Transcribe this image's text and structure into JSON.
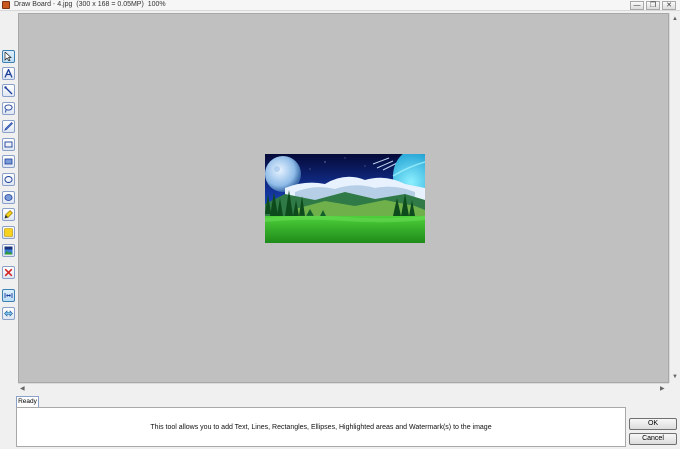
{
  "window": {
    "app_title": "Draw Board",
    "separator": "-",
    "file_name": "4.jpg",
    "file_info": "(300 x 168 = 0.05MP)",
    "zoom": "100%",
    "minimize_glyph": "—",
    "restore_glyph": "❐",
    "close_glyph": "✕"
  },
  "toolbar": {
    "tools": [
      {
        "name": "select",
        "icon": "pointer-icon"
      },
      {
        "name": "text",
        "icon": "text-icon"
      },
      {
        "name": "line",
        "icon": "line-icon"
      },
      {
        "name": "lasso",
        "icon": "lasso-icon"
      },
      {
        "name": "pen",
        "icon": "pen-icon"
      },
      {
        "name": "rectangle",
        "icon": "rectangle-icon"
      },
      {
        "name": "filled-rectangle",
        "icon": "filled-rectangle-icon"
      },
      {
        "name": "ellipse",
        "icon": "ellipse-icon"
      },
      {
        "name": "filled-ellipse",
        "icon": "filled-ellipse-icon"
      },
      {
        "name": "highlighter",
        "icon": "highlighter-icon"
      },
      {
        "name": "highlight-area",
        "icon": "highlight-area-icon"
      },
      {
        "name": "watermark",
        "icon": "watermark-image-icon"
      },
      {
        "name": "delete",
        "icon": "delete-icon"
      },
      {
        "name": "fit",
        "icon": "fit-to-window-icon"
      },
      {
        "name": "actual-size",
        "icon": "actual-size-icon"
      }
    ]
  },
  "status": {
    "tab_label": "Ready",
    "message": "This tool allows you to add Text, Lines, Rectangles, Ellipses, Highlighted areas and Watermark(s) to the image"
  },
  "buttons": {
    "ok": "OK",
    "cancel": "Cancel"
  },
  "colors": {
    "canvas_background": "#c0c0c0",
    "active_tool": "#b9dcf6",
    "delete_icon": "#d42020"
  }
}
